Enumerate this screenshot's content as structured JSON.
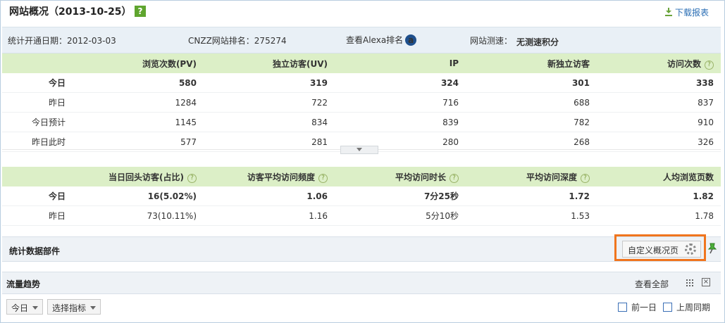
{
  "header": {
    "title": "网站概况（2013-10-25）",
    "help_icon": "?",
    "download_label": "下载报表"
  },
  "info": {
    "start_date": "统计开通日期：2012-03-03",
    "cnzz_rank": "CNZZ网站排名：275274",
    "alexa": "查看Alexa排名",
    "speed_label": "网站测速：",
    "speed_value": "无测速积分"
  },
  "table1": {
    "headers": [
      "",
      "浏览次数(PV)",
      "独立访客(UV)",
      "IP",
      "新独立访客",
      "访问次数"
    ],
    "rows": [
      [
        "今日",
        "580",
        "319",
        "324",
        "301",
        "338"
      ],
      [
        "昨日",
        "1284",
        "722",
        "716",
        "688",
        "837"
      ],
      [
        "今日预计",
        "1145",
        "834",
        "839",
        "782",
        "910"
      ],
      [
        "昨日此时",
        "577",
        "281",
        "280",
        "268",
        "326"
      ]
    ]
  },
  "table2": {
    "headers": [
      "",
      "当日回头访客(占比)",
      "访客平均访问频度",
      "平均访问时长",
      "平均访问深度",
      "人均浏览页数"
    ],
    "rows": [
      [
        "今日",
        "16(5.02%)",
        "1.06",
        "7分25秒",
        "1.72",
        "1.82"
      ],
      [
        "昨日",
        "73(10.11%)",
        "1.16",
        "5分10秒",
        "1.53",
        "1.78"
      ]
    ]
  },
  "section": {
    "title": "统计数据部件",
    "custom_label": "自定义概况页"
  },
  "trend": {
    "title": "流量趋势",
    "view_all": "查看全部",
    "close": "×",
    "dropdown_day": "今日",
    "dropdown_metric": "选择指标",
    "check_prev_day": "前一日",
    "check_last_week": "上周同期"
  },
  "colors": {
    "accent_green": "#dcefc7",
    "highlight": "#f0751e",
    "link_blue": "#2a6eb4"
  }
}
